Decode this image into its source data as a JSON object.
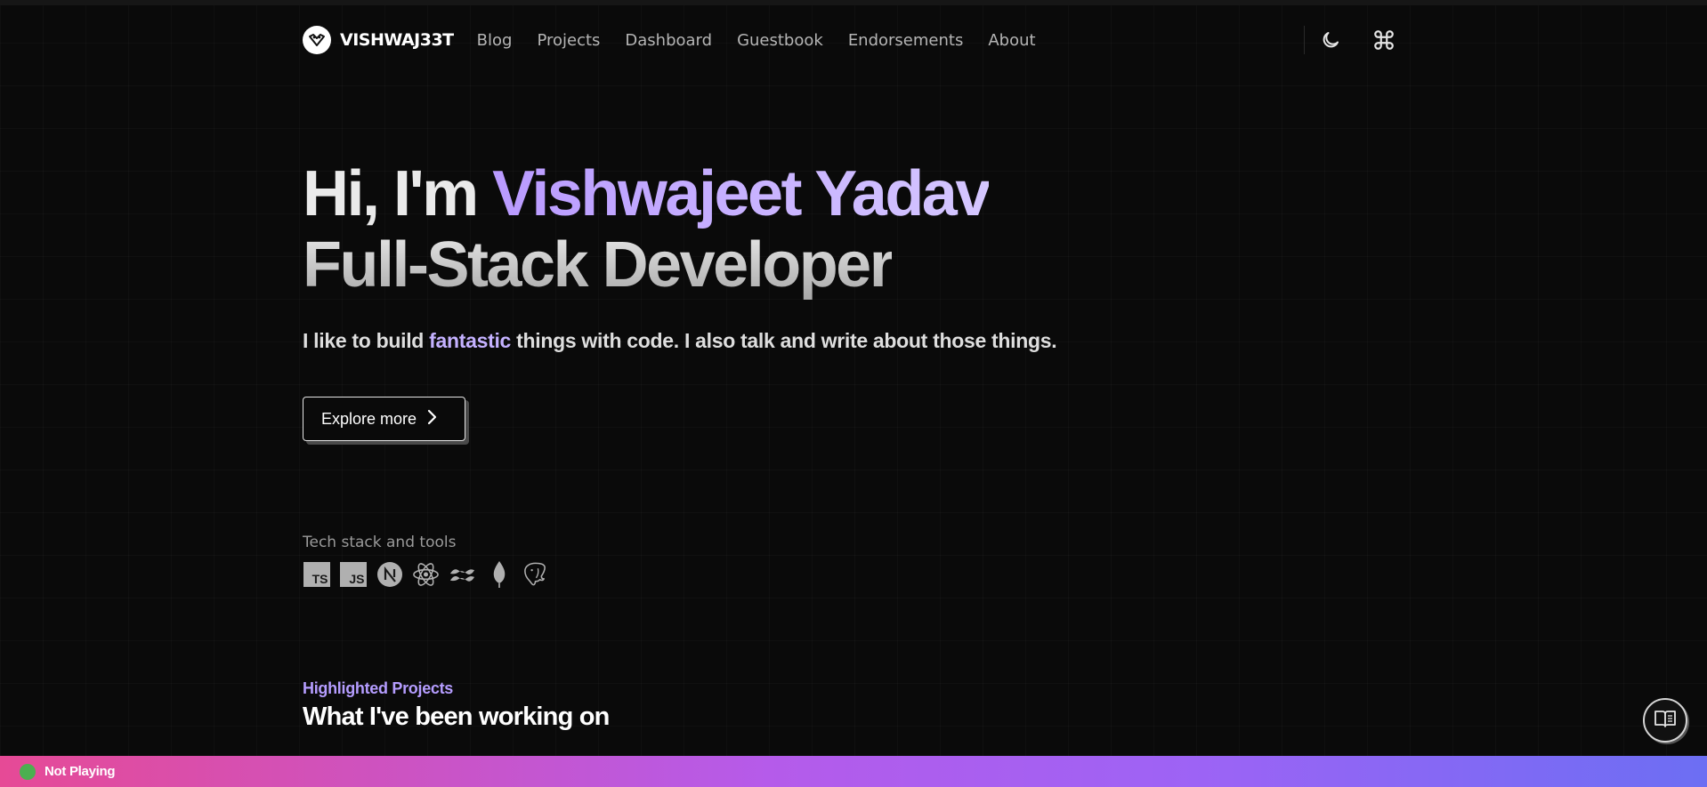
{
  "brand": {
    "name": "VISHWAJ33T",
    "logo_icon": "sitelogo-icon"
  },
  "nav": [
    {
      "label": "Blog"
    },
    {
      "label": "Projects"
    },
    {
      "label": "Dashboard"
    },
    {
      "label": "Guestbook"
    },
    {
      "label": "Endorsements"
    },
    {
      "label": "About"
    }
  ],
  "header_actions": {
    "theme_icon": "moon-icon",
    "command_icon": "command-icon"
  },
  "hero": {
    "greeting": "Hi, I'm ",
    "name": "Vishwajeet Yadav",
    "role": "Full-Stack Developer",
    "tagline_before": "I like to build ",
    "tagline_accent": "fantastic",
    "tagline_after": " things with code. I also talk and write about those things.",
    "cta_label": "Explore more"
  },
  "tech_stack": {
    "label": "Tech stack and tools",
    "items": [
      {
        "name": "typescript-icon",
        "text": "TS"
      },
      {
        "name": "javascript-icon",
        "text": "JS"
      },
      {
        "name": "nextjs-icon"
      },
      {
        "name": "react-icon"
      },
      {
        "name": "tailwind-icon"
      },
      {
        "name": "mongodb-icon"
      },
      {
        "name": "postgresql-icon"
      }
    ]
  },
  "highlighted": {
    "label": "Highlighted Projects",
    "title": "What I've been working on"
  },
  "now_playing": {
    "status": "Not Playing"
  },
  "colors": {
    "accent": "#c4b1ff",
    "background": "#0a0a0a",
    "footer_start": "#e64a96",
    "footer_end": "#6c6ef3"
  }
}
